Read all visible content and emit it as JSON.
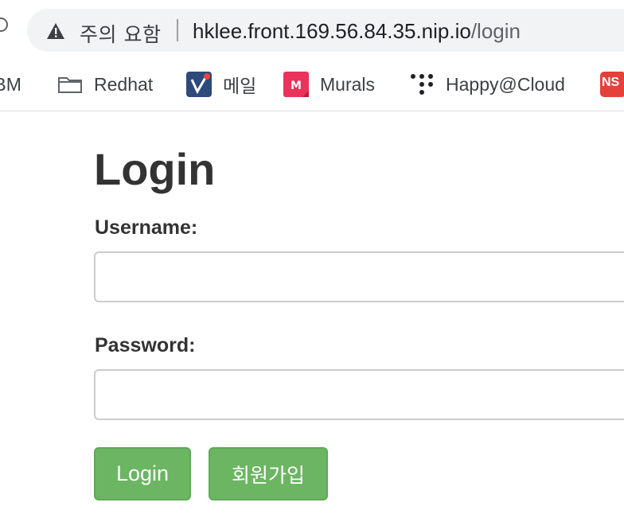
{
  "browser": {
    "security_warning": "주의 요함",
    "url_host": "hklee.front.169.56.84.35.nip.io",
    "url_path": "/login",
    "bookmarks": [
      {
        "label": "IBM",
        "icon": "ibm-icon"
      },
      {
        "label": "Redhat",
        "icon": "folder-icon"
      },
      {
        "label": "메일",
        "icon": "mail-app-icon"
      },
      {
        "label": "Murals",
        "icon": "mural-icon"
      },
      {
        "label": "Happy@Cloud",
        "icon": "dots-grid-icon"
      },
      {
        "label": "NS",
        "icon": "ns-icon"
      }
    ]
  },
  "page": {
    "title": "Login",
    "username_label": "Username:",
    "username_value": "",
    "password_label": "Password:",
    "password_value": "",
    "login_button": "Login",
    "signup_button": "회원가입"
  },
  "colors": {
    "button_bg": "#6cb563",
    "button_text": "#ffffff",
    "text": "#333333",
    "omnibox_bg": "#f1f3f4"
  }
}
